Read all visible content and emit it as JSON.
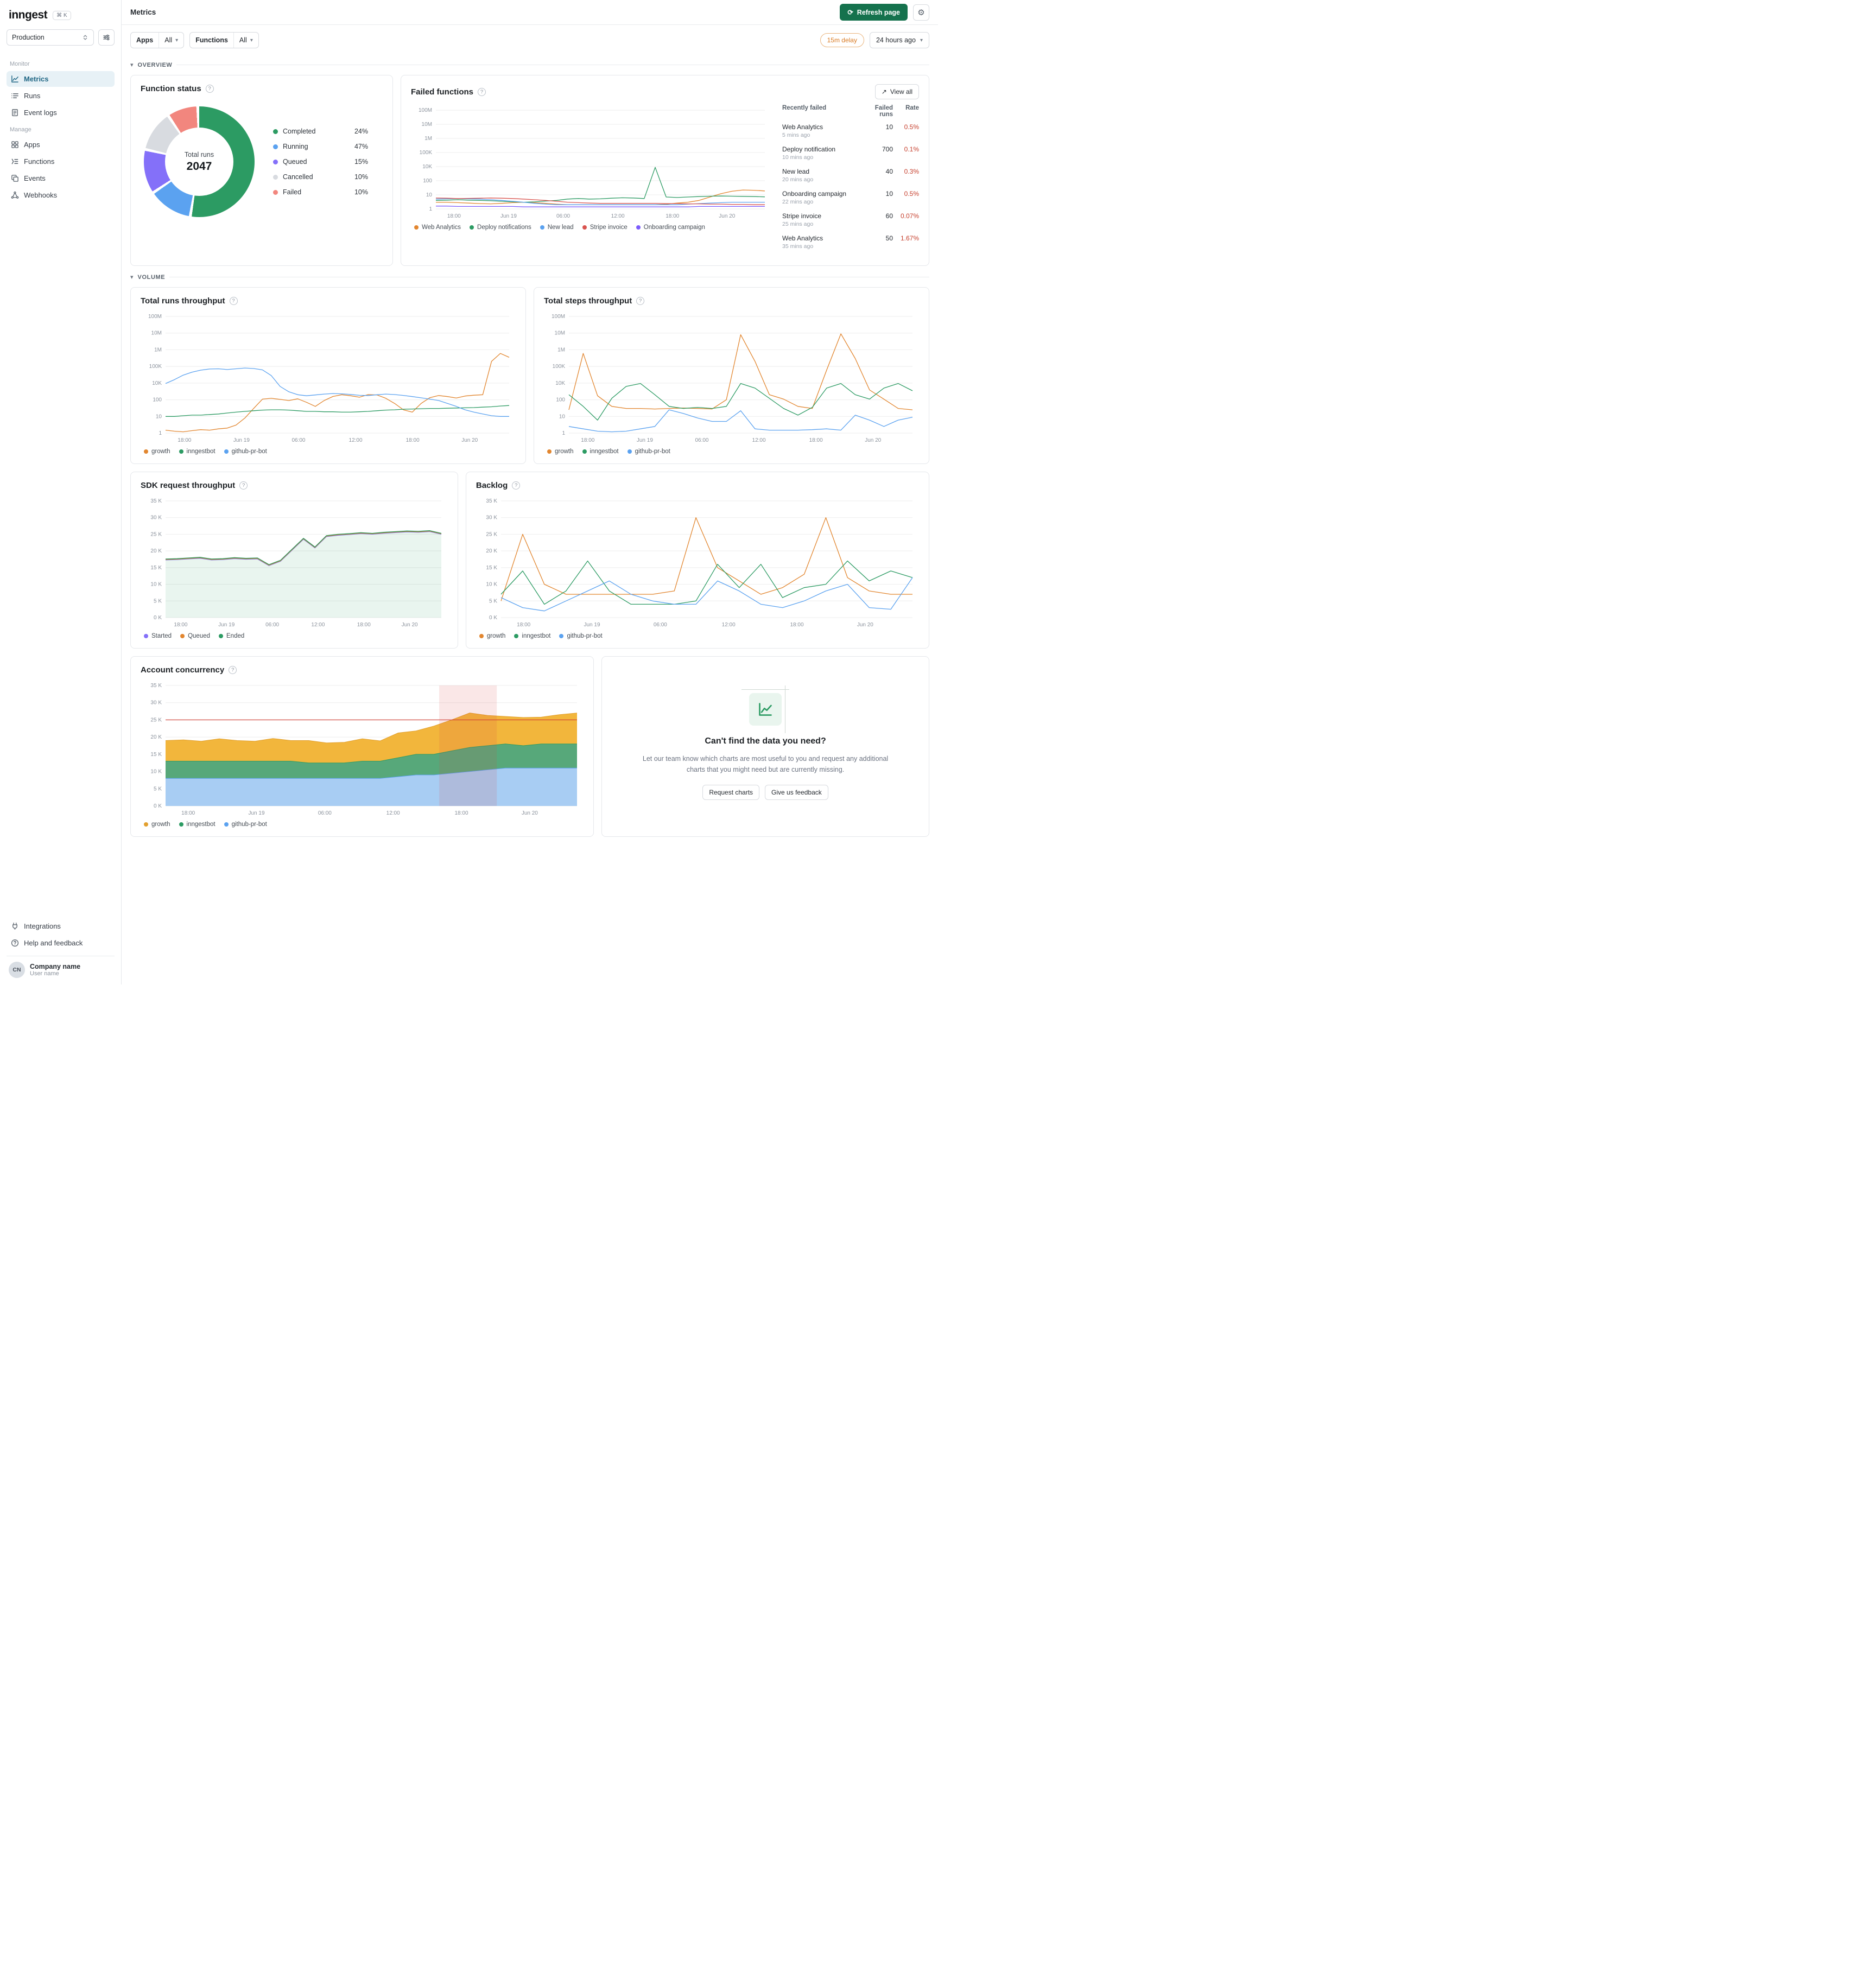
{
  "sidebar": {
    "logo_text": "inngest",
    "kbd_shortcut": "⌘ K",
    "env_selector": {
      "value": "Production"
    },
    "sections": [
      {
        "heading": "Monitor",
        "items": [
          {
            "label": "Metrics"
          },
          {
            "label": "Runs"
          },
          {
            "label": "Event logs"
          }
        ]
      },
      {
        "heading": "Manage",
        "items": [
          {
            "label": "Apps"
          },
          {
            "label": "Functions"
          },
          {
            "label": "Events"
          },
          {
            "label": "Webhooks"
          }
        ]
      }
    ],
    "footer_items": [
      {
        "label": "Integrations"
      },
      {
        "label": "Help and feedback"
      }
    ],
    "account": {
      "company": "Company name",
      "user": "User name",
      "avatar_initials": "CN"
    }
  },
  "header": {
    "title": "Metrics",
    "refresh_button": "Refresh page"
  },
  "filter_bar": {
    "apps_label": "Apps",
    "apps_value": "All",
    "functions_label": "Functions",
    "functions_value": "All",
    "delay_badge": "15m delay",
    "time_range": "24 hours ago"
  },
  "section_headers": {
    "overview": "OVERVIEW",
    "volume": "VOLUME"
  },
  "function_status": {
    "title": "Function status",
    "total_label": "Total runs",
    "total_value": "2047",
    "legend": [
      {
        "label": "Completed",
        "pct": "24%",
        "color": "#2c9b63",
        "frac": 0.53
      },
      {
        "label": "Running",
        "pct": "47%",
        "color": "#5ba2f0",
        "frac": 0.13
      },
      {
        "label": "Queued",
        "pct": "15%",
        "color": "#8470f9",
        "frac": 0.13
      },
      {
        "label": "Cancelled",
        "pct": "10%",
        "color": "#d8dbe0",
        "frac": 0.12
      },
      {
        "label": "Failed",
        "pct": "10%",
        "color": "#f2867e",
        "frac": 0.09
      }
    ]
  },
  "failed_functions": {
    "title": "Failed functions",
    "view_all": "View all",
    "table": {
      "headers": [
        "Recently failed",
        "Failed runs",
        "Rate"
      ],
      "rows": [
        {
          "name": "Web Analytics",
          "time": "5 mins ago",
          "runs": "10",
          "rate": "0.5%"
        },
        {
          "name": "Deploy notification",
          "time": "10 mins ago",
          "runs": "700",
          "rate": "0.1%"
        },
        {
          "name": "New lead",
          "time": "20 mins ago",
          "runs": "40",
          "rate": "0.3%"
        },
        {
          "name": "Onboarding campaign",
          "time": "22 mins ago",
          "runs": "10",
          "rate": "0.5%"
        },
        {
          "name": "Stripe invoice",
          "time": "25 mins ago",
          "runs": "60",
          "rate": "0.07%"
        },
        {
          "name": "Web Analytics",
          "time": "35 mins ago",
          "runs": "50",
          "rate": "1.67%"
        }
      ]
    }
  },
  "cards": {
    "total_runs_title": "Total runs throughput",
    "total_steps_title": "Total steps throughput",
    "sdk_title": "SDK request throughput",
    "backlog_title": "Backlog",
    "account_title": "Account concurrency"
  },
  "promo": {
    "heading": "Can't find the data you need?",
    "body": "Let our team know which charts are most useful to you and request any additional charts that you might need but are currently missing.",
    "request_button": "Request charts",
    "feedback_button": "Give us feedback"
  },
  "charts": {
    "failed": {
      "type": "line",
      "scale": "log",
      "yticks": [
        1,
        10,
        100,
        10000,
        100000,
        1000000,
        10000000,
        100000000
      ],
      "ytick_labels": [
        "1",
        "10",
        "100",
        "10K",
        "100K",
        "1M",
        "10M",
        "100M"
      ],
      "xticks": [
        "18:00",
        "Jun 19",
        "06:00",
        "12:00",
        "18:00",
        "Jun 20"
      ],
      "series": [
        {
          "name": "Web Analytics",
          "color": "#e2862f",
          "values": [
            3,
            3,
            2.8,
            2.6,
            2.4,
            2.3,
            2.5,
            2.8,
            3,
            2.8,
            2.5,
            2.2,
            2,
            2,
            2,
            2,
            2,
            2,
            2,
            2,
            2,
            2.2,
            2.6,
            3,
            4,
            7,
            12,
            18,
            22,
            21,
            19
          ]
        },
        {
          "name": "Deploy notifications",
          "color": "#2c9b63",
          "values": [
            4,
            4.2,
            4.5,
            4.2,
            4,
            3.8,
            3.5,
            3.2,
            3,
            3.2,
            3.6,
            4,
            5,
            5.5,
            5,
            5.2,
            5.8,
            6.2,
            6,
            5.5,
            8000,
            7,
            6.5,
            7,
            7.5,
            8,
            8.2,
            8,
            7.8,
            7.5,
            7.2
          ]
        },
        {
          "name": "New lead",
          "color": "#5ba2f0",
          "values": [
            5,
            5.2,
            5.5,
            5.2,
            5,
            4.5,
            4,
            3.5,
            3,
            2.5,
            2.2,
            2,
            2,
            2,
            2,
            2,
            2,
            2,
            2,
            2,
            2,
            2,
            2,
            2.2,
            2.4,
            2.6,
            2.8,
            3,
            3,
            3,
            3
          ]
        },
        {
          "name": "Stripe invoice",
          "color": "#d9544f",
          "values": [
            6,
            5.8,
            5.5,
            5.6,
            5.8,
            6,
            5.8,
            5.5,
            5,
            4.5,
            4,
            3.5,
            3,
            2.8,
            2.6,
            2.5,
            2.5,
            2.5,
            2.5,
            2.5,
            2.5,
            2.4,
            2.4,
            2.3,
            2.3,
            2.2,
            2.2,
            2.1,
            2.1,
            2,
            2
          ]
        },
        {
          "name": "Onboarding campaign",
          "color": "#7c5cfc",
          "values": [
            1.6,
            1.6,
            1.5,
            1.5,
            1.5,
            1.5,
            1.5,
            1.5,
            1.4,
            1.4,
            1.4,
            1.4,
            1.4,
            1.4,
            1.4,
            1.4,
            1.4,
            1.4,
            1.4,
            1.4,
            1.4,
            1.4,
            1.4,
            1.4,
            1.5,
            1.5,
            1.5,
            1.5,
            1.5,
            1.5,
            1.5
          ]
        }
      ]
    },
    "total_runs": {
      "type": "line",
      "scale": "log",
      "yticks": [
        1,
        10,
        100,
        10000,
        100000,
        1000000,
        10000000,
        100000000
      ],
      "ytick_labels": [
        "1",
        "10",
        "100",
        "10K",
        "100K",
        "1M",
        "10M",
        "100M"
      ],
      "xticks": [
        "18:00",
        "Jun 19",
        "06:00",
        "12:00",
        "18:00",
        "Jun 20"
      ],
      "series": [
        {
          "name": "growth",
          "color": "#e2862f",
          "values": [
            1.5,
            1.3,
            1.2,
            1.4,
            1.6,
            1.5,
            1.8,
            2,
            3,
            8,
            30,
            120,
            150,
            110,
            90,
            130,
            70,
            40,
            90,
            250,
            400,
            300,
            200,
            420,
            380,
            150,
            60,
            25,
            18,
            60,
            180,
            320,
            240,
            160,
            280,
            350,
            400,
            200000,
            600000,
            350000
          ]
        },
        {
          "name": "inngestbot",
          "color": "#2c9b63",
          "values": [
            10,
            10,
            11,
            12,
            12,
            13,
            14,
            16,
            18,
            20,
            22,
            24,
            25,
            25,
            24,
            22,
            20,
            20,
            19,
            19,
            18,
            18,
            19,
            20,
            22,
            24,
            25,
            27,
            28,
            29,
            30,
            30,
            31,
            32,
            33,
            34,
            36,
            38,
            42,
            45
          ]
        },
        {
          "name": "github-pr-bot",
          "color": "#5ba2f0",
          "values": [
            9000,
            16000,
            30000,
            45000,
            60000,
            70000,
            72000,
            65000,
            72000,
            80000,
            75000,
            62000,
            28000,
            4000,
            900,
            400,
            300,
            380,
            480,
            560,
            520,
            430,
            340,
            320,
            400,
            480,
            420,
            330,
            240,
            170,
            120,
            90,
            60,
            40,
            25,
            18,
            14,
            11,
            10,
            10
          ]
        }
      ]
    },
    "total_steps": {
      "type": "line",
      "scale": "log",
      "yticks": [
        1,
        10,
        100,
        10000,
        100000,
        1000000,
        10000000,
        100000000
      ],
      "ytick_labels": [
        "1",
        "10",
        "100",
        "10K",
        "100K",
        "1M",
        "10M",
        "100M"
      ],
      "xticks": [
        "18:00",
        "Jun 19",
        "06:00",
        "12:00",
        "18:00",
        "Jun 20"
      ],
      "series": [
        {
          "name": "growth",
          "color": "#e2862f",
          "values": [
            25,
            600000,
            300,
            40,
            30,
            30,
            28,
            30,
            32,
            30,
            28,
            100,
            8000000,
            200000,
            400,
            120,
            40,
            30,
            60000,
            9000000,
            300000,
            1500,
            120,
            30,
            25
          ]
        },
        {
          "name": "inngestbot",
          "color": "#2c9b63",
          "values": [
            400,
            40,
            6,
            150,
            4000,
            9000,
            400,
            40,
            30,
            35,
            30,
            40,
            9000,
            2500,
            150,
            30,
            12,
            35,
            2500,
            9000,
            400,
            120,
            2500,
            9000,
            1200
          ]
        },
        {
          "name": "github-pr-bot",
          "color": "#5ba2f0",
          "values": [
            2.5,
            1.8,
            1.3,
            1.2,
            1.3,
            1.8,
            2.5,
            25,
            15,
            8,
            5,
            5,
            22,
            1.8,
            1.5,
            1.5,
            1.5,
            1.6,
            1.8,
            1.5,
            12,
            6,
            2.5,
            6,
            9
          ]
        }
      ]
    },
    "sdk": {
      "type": "line",
      "scale": "linear",
      "ymax": 35,
      "ytick_labels": [
        "0 K",
        "5 K",
        "10 K",
        "15 K",
        "20 K",
        "25 K",
        "30 K",
        "35 K"
      ],
      "xticks": [
        "18:00",
        "Jun 19",
        "06:00",
        "12:00",
        "18:00",
        "Jun 20"
      ],
      "series": [
        {
          "name": "Started",
          "color": "#8470f9",
          "values": [
            17.3,
            17.4,
            17.6,
            17.8,
            17.3,
            17.4,
            17.7,
            17.5,
            17.6,
            15.6,
            16.9,
            20.2,
            23.5,
            20.9,
            24.3,
            24.7,
            24.9,
            25.2,
            25.0,
            25.3,
            25.5,
            25.7,
            25.6,
            25.8,
            25.0
          ]
        },
        {
          "name": "Queued",
          "color": "#e2862f",
          "values": [
            17.45,
            17.55,
            17.75,
            17.95,
            17.45,
            17.55,
            17.85,
            17.65,
            17.75,
            15.75,
            17.05,
            20.35,
            23.65,
            21.05,
            24.45,
            24.85,
            25.05,
            25.35,
            25.15,
            25.45,
            25.65,
            25.85,
            25.75,
            25.95,
            25.15
          ]
        },
        {
          "name": "Ended",
          "color": "#2c9b63",
          "fillArea": "rgba(44,155,99,0.10)",
          "values": [
            17.6,
            17.7,
            17.9,
            18.1,
            17.6,
            17.7,
            18.0,
            17.8,
            17.9,
            15.9,
            17.2,
            20.5,
            23.8,
            21.2,
            24.6,
            25.0,
            25.2,
            25.5,
            25.3,
            25.6,
            25.8,
            26.0,
            25.9,
            26.1,
            25.3
          ]
        }
      ]
    },
    "backlog": {
      "type": "line",
      "scale": "linear",
      "ymax": 35,
      "ytick_labels": [
        "0 K",
        "5 K",
        "10 K",
        "15 K",
        "20 K",
        "25 K",
        "30 K",
        "35 K"
      ],
      "xticks": [
        "18:00",
        "Jun 19",
        "06:00",
        "12:00",
        "18:00",
        "Jun 20"
      ],
      "series": [
        {
          "name": "growth",
          "color": "#e2862f",
          "values": [
            5,
            25,
            10,
            7,
            7,
            7,
            7,
            7,
            8,
            30,
            15,
            11,
            7,
            9,
            13,
            30,
            12,
            8,
            7,
            7
          ]
        },
        {
          "name": "inngestbot",
          "color": "#2c9b63",
          "values": [
            7,
            14,
            4,
            8,
            17,
            8,
            4,
            4,
            4,
            5,
            16,
            9,
            16,
            6,
            9,
            10,
            17,
            11,
            14,
            12
          ]
        },
        {
          "name": "github-pr-bot",
          "color": "#5ba2f0",
          "values": [
            6,
            3,
            2,
            5,
            8,
            11,
            7,
            5,
            4,
            4,
            11,
            8,
            4,
            3,
            5,
            8,
            10,
            3,
            2.5,
            12
          ]
        }
      ]
    },
    "account": {
      "type": "area",
      "scale": "linear",
      "ymax": 35,
      "stacked": true,
      "refline": 25,
      "band": [
        0.665,
        0.805
      ],
      "ytick_labels": [
        "0 K",
        "5 K",
        "10 K",
        "15 K",
        "20 K",
        "25 K",
        "30 K",
        "35 K"
      ],
      "xticks": [
        "18:00",
        "Jun 19",
        "06:00",
        "12:00",
        "18:00",
        "Jun 20"
      ],
      "series": [
        {
          "name": "github-pr-bot",
          "color": "#5ba2f0",
          "fill": "#a8cdf3",
          "values": [
            8,
            8,
            8,
            8,
            8,
            8,
            8,
            8,
            8,
            8,
            8,
            8,
            8,
            8.5,
            9,
            9,
            9.5,
            10,
            10.5,
            11,
            11,
            11,
            11,
            11
          ]
        },
        {
          "name": "inngestbot",
          "color": "#2c9b63",
          "fill": "#57a87a",
          "values": [
            5,
            5,
            5,
            5,
            5,
            5,
            5,
            5,
            4.5,
            4.5,
            4.5,
            5,
            5,
            5.5,
            6,
            6,
            6.5,
            7,
            7,
            7,
            6.5,
            7,
            7,
            7
          ]
        },
        {
          "name": "growth",
          "color": "#e2a02f",
          "fill": "#f2b63c",
          "values": [
            6,
            6.2,
            5.8,
            6.5,
            6,
            5.8,
            6.6,
            6,
            6.5,
            5.8,
            6,
            6.5,
            5.9,
            7.2,
            6.8,
            8.2,
            9,
            10,
            8.8,
            8,
            8.2,
            7.8,
            8.5,
            9
          ]
        }
      ]
    }
  }
}
